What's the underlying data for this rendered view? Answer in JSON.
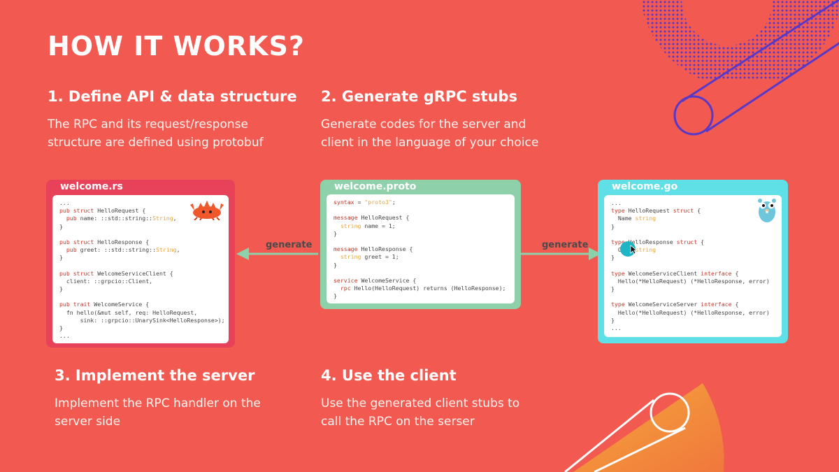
{
  "slide": {
    "title": "HOW IT WORKS?",
    "colors": {
      "background": "#f25a51",
      "rust": "#e8425a",
      "proto": "#8ed0a9",
      "go": "#5fe0e6",
      "accent_line": "#5838c9"
    }
  },
  "steps": [
    {
      "heading": "1. Define API & data structure",
      "text": "The RPC and its request/response structure are defined using protobuf"
    },
    {
      "heading": "2. Generate gRPC stubs",
      "text": "Generate codes for the server and client in the language of your choice"
    },
    {
      "heading": "3. Implement the server",
      "text": "Implement the RPC handler on the server side"
    },
    {
      "heading": "4. Use the client",
      "text": "Use the generated client stubs to call the RPC on the serser"
    }
  ],
  "arrows": {
    "left_label": "generate",
    "right_label": "generate"
  },
  "cards": {
    "rust": {
      "filename": "welcome.rs",
      "mascot": "ferris-crab-icon",
      "lines": [
        [
          {
            "t": "..."
          }
        ],
        [
          {
            "t": "pub struct ",
            "c": "kw"
          },
          {
            "t": "HelloRequest {"
          }
        ],
        [
          {
            "t": "  "
          },
          {
            "t": "pub ",
            "c": "kw"
          },
          {
            "t": "name: ::std::string::"
          },
          {
            "t": "String",
            "c": "ty"
          },
          {
            "t": ","
          }
        ],
        [
          {
            "t": "}"
          }
        ],
        [
          {
            "t": ""
          }
        ],
        [
          {
            "t": "pub struct ",
            "c": "kw"
          },
          {
            "t": "HelloResponse {"
          }
        ],
        [
          {
            "t": "  "
          },
          {
            "t": "pub ",
            "c": "kw"
          },
          {
            "t": "greet: ::std::string::"
          },
          {
            "t": "String",
            "c": "ty"
          },
          {
            "t": ","
          }
        ],
        [
          {
            "t": "}"
          }
        ],
        [
          {
            "t": ""
          }
        ],
        [
          {
            "t": "pub struct ",
            "c": "kw"
          },
          {
            "t": "WelcomeServiceClient {"
          }
        ],
        [
          {
            "t": "  client: ::grpcio::Client,"
          }
        ],
        [
          {
            "t": "}"
          }
        ],
        [
          {
            "t": ""
          }
        ],
        [
          {
            "t": "pub trait ",
            "c": "kw"
          },
          {
            "t": "WelcomeService {"
          }
        ],
        [
          {
            "t": "  fn hello(&mut self, req: HelloRequest,"
          }
        ],
        [
          {
            "t": "      sink: ::grpcio::UnarySink<HelloResponse>);"
          }
        ],
        [
          {
            "t": "}"
          }
        ],
        [
          {
            "t": "..."
          }
        ]
      ]
    },
    "proto": {
      "filename": "welcome.proto",
      "lines": [
        [
          {
            "t": "syntax",
            "c": "kw"
          },
          {
            "t": " = "
          },
          {
            "t": "\"proto3\"",
            "c": "ty"
          },
          {
            "t": ";"
          }
        ],
        [
          {
            "t": ""
          }
        ],
        [
          {
            "t": "message ",
            "c": "kw"
          },
          {
            "t": "HelloRequest {"
          }
        ],
        [
          {
            "t": "  "
          },
          {
            "t": "string",
            "c": "ty"
          },
          {
            "t": " name = 1;"
          }
        ],
        [
          {
            "t": "}"
          }
        ],
        [
          {
            "t": ""
          }
        ],
        [
          {
            "t": "message ",
            "c": "kw"
          },
          {
            "t": "HelloResponse {"
          }
        ],
        [
          {
            "t": "  "
          },
          {
            "t": "string",
            "c": "ty"
          },
          {
            "t": " greet = 1;"
          }
        ],
        [
          {
            "t": "}"
          }
        ],
        [
          {
            "t": ""
          }
        ],
        [
          {
            "t": "service ",
            "c": "kw"
          },
          {
            "t": "WelcomeService {"
          }
        ],
        [
          {
            "t": "  "
          },
          {
            "t": "rpc ",
            "c": "kw"
          },
          {
            "t": "Hello(HelloRequest) returns (HelloResponse);"
          }
        ],
        [
          {
            "t": "}"
          }
        ]
      ]
    },
    "go": {
      "filename": "welcome.go",
      "mascot": "gopher-icon",
      "lines": [
        [
          {
            "t": "..."
          }
        ],
        [
          {
            "t": "type ",
            "c": "kw"
          },
          {
            "t": "HelloRequest "
          },
          {
            "t": "struct",
            "c": "kw"
          },
          {
            "t": " {"
          }
        ],
        [
          {
            "t": "  Name "
          },
          {
            "t": "string",
            "c": "ty"
          }
        ],
        [
          {
            "t": "}"
          }
        ],
        [
          {
            "t": ""
          }
        ],
        [
          {
            "t": "type ",
            "c": "kw"
          },
          {
            "t": "HelloResponse "
          },
          {
            "t": "struct",
            "c": "kw"
          },
          {
            "t": " {"
          }
        ],
        [
          {
            "t": "  G    "
          },
          {
            "t": "string",
            "c": "ty"
          }
        ],
        [
          {
            "t": "}"
          }
        ],
        [
          {
            "t": ""
          }
        ],
        [
          {
            "t": "type ",
            "c": "kw"
          },
          {
            "t": "WelcomeServiceClient "
          },
          {
            "t": "interface",
            "c": "kw"
          },
          {
            "t": " {"
          }
        ],
        [
          {
            "t": "  Hello(*HelloRequest) (*HelloResponse, error)"
          }
        ],
        [
          {
            "t": "}"
          }
        ],
        [
          {
            "t": ""
          }
        ],
        [
          {
            "t": "type ",
            "c": "kw"
          },
          {
            "t": "WelcomeServiceServer "
          },
          {
            "t": "interface",
            "c": "kw"
          },
          {
            "t": " {"
          }
        ],
        [
          {
            "t": "  Hello(*HelloRequest) (*HelloResponse, error)"
          }
        ],
        [
          {
            "t": "}"
          }
        ],
        [
          {
            "t": "..."
          }
        ]
      ]
    }
  }
}
